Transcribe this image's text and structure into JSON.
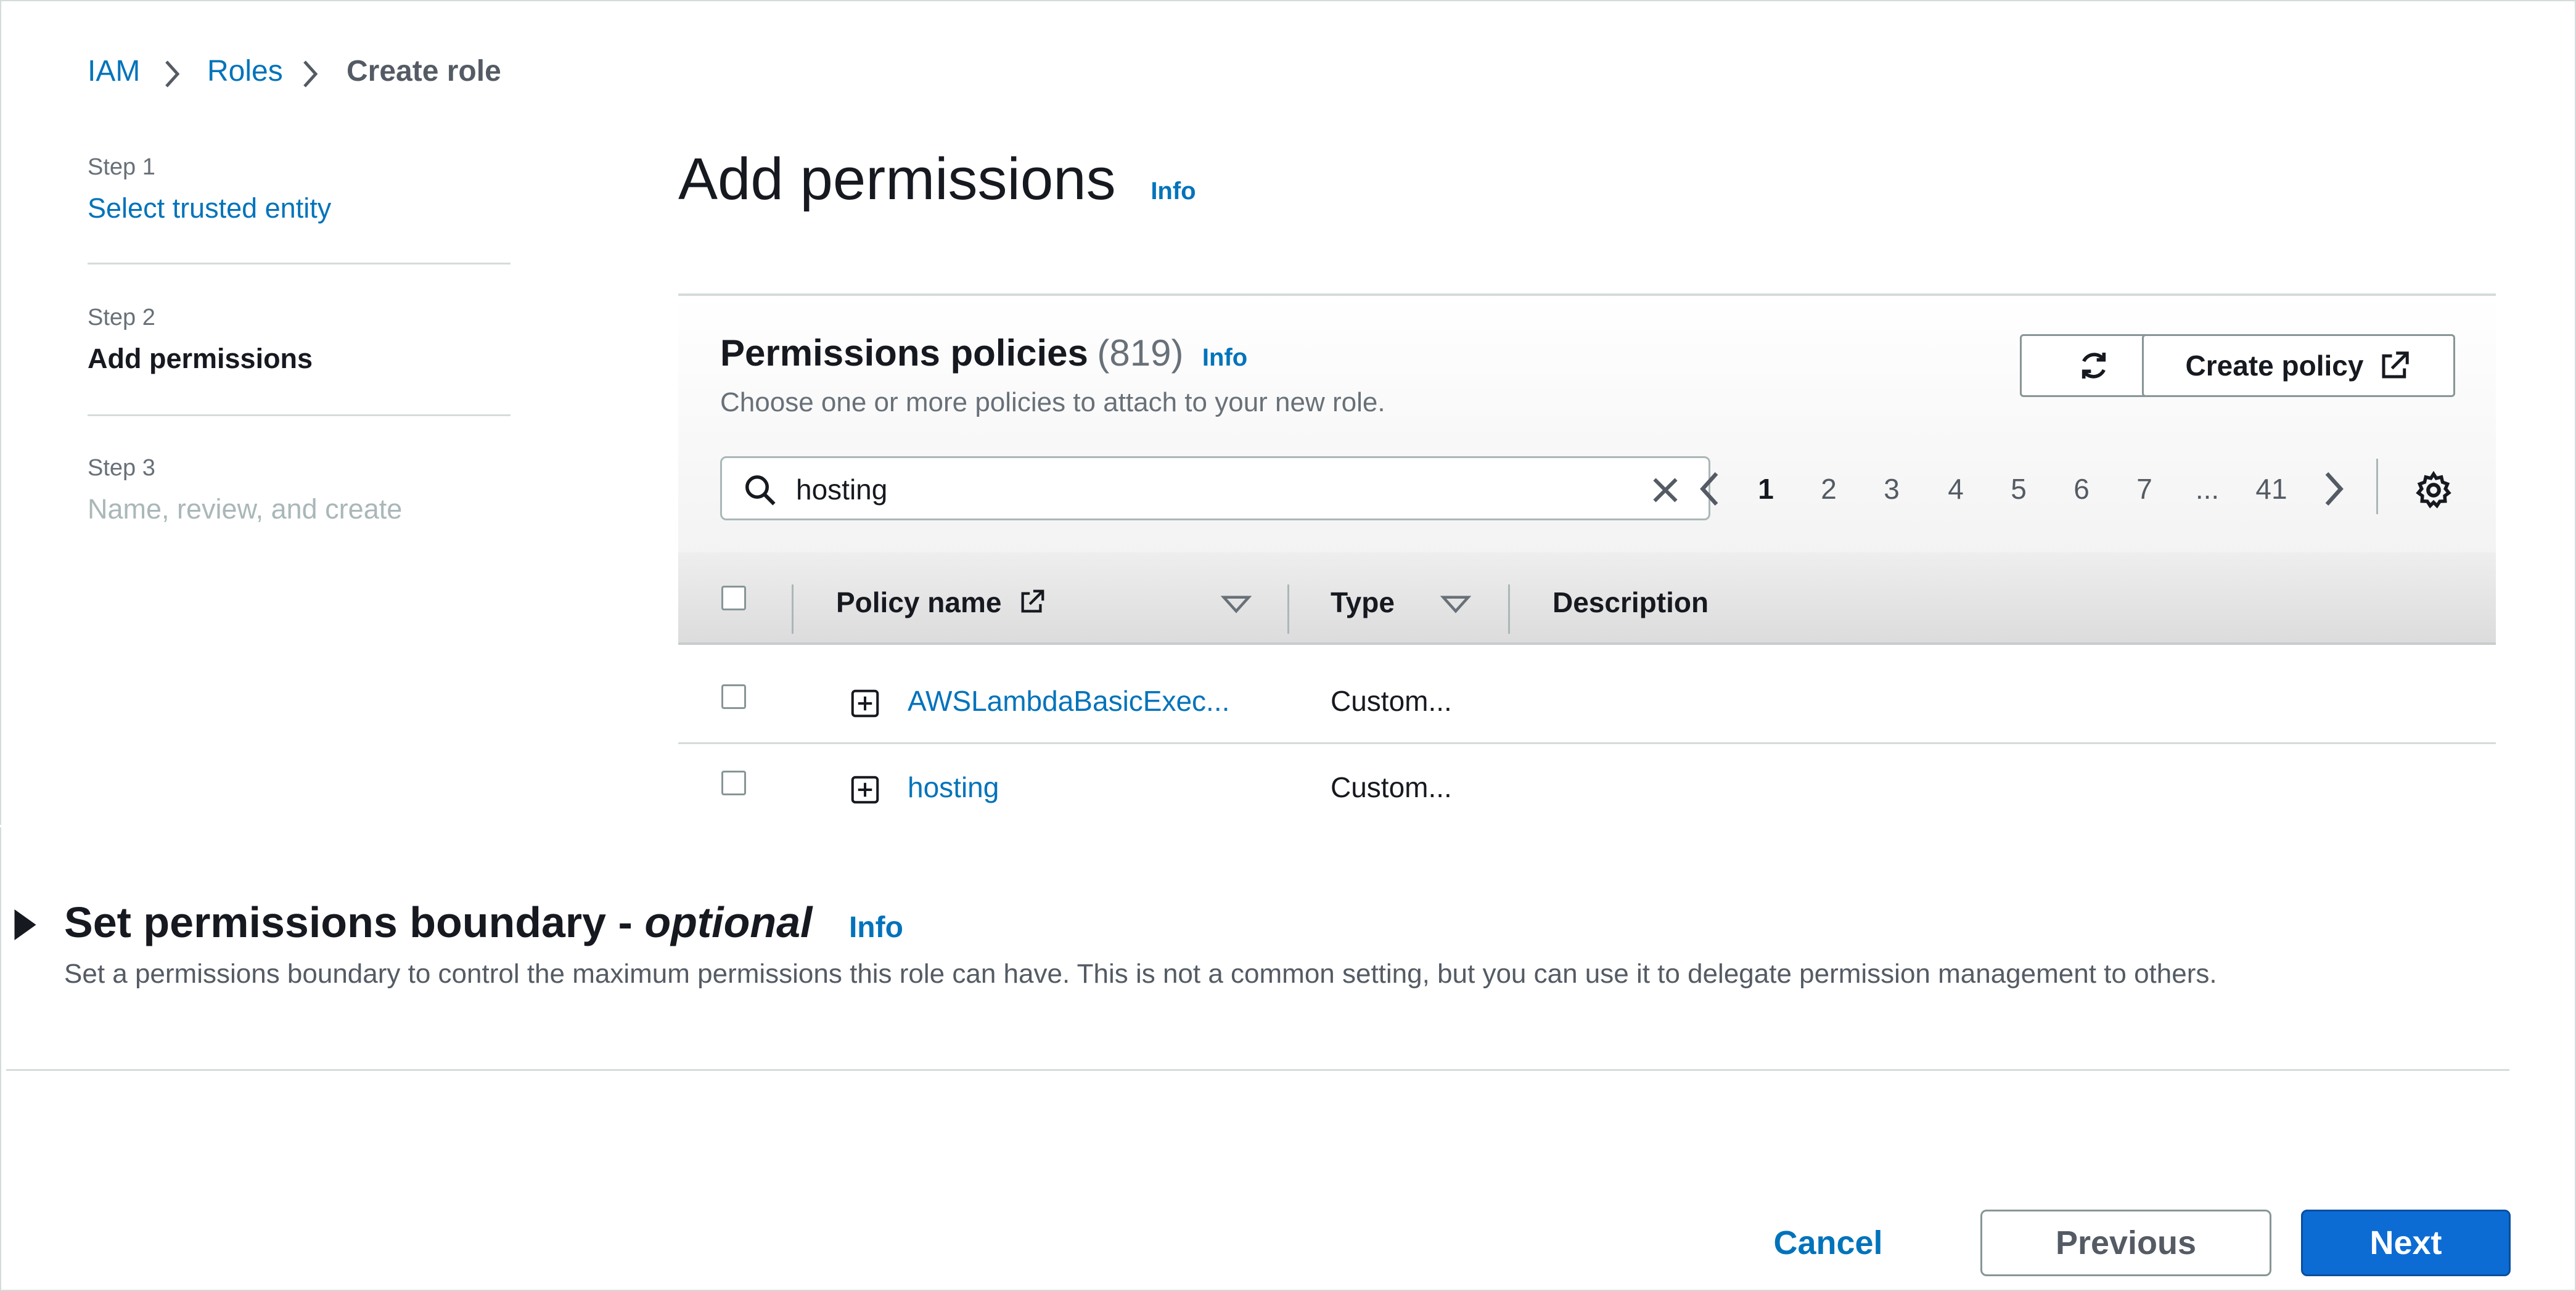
{
  "breadcrumb": {
    "items": [
      "IAM",
      "Roles",
      "Create role"
    ]
  },
  "steps": [
    {
      "step": "Step 1",
      "title": "Select trusted entity"
    },
    {
      "step": "Step 2",
      "title": "Add permissions"
    },
    {
      "step": "Step 3",
      "title": "Name, review, and create"
    }
  ],
  "page": {
    "title": "Add permissions",
    "info": "Info"
  },
  "permissions": {
    "title": "Permissions policies",
    "count": "(819)",
    "info": "Info",
    "subtitle": "Choose one or more policies to attach to your new role.",
    "create_policy_label": "Create policy",
    "search_value": "hosting",
    "pagination": {
      "pages": [
        "1",
        "2",
        "3",
        "4",
        "5",
        "6",
        "7",
        "...",
        "41"
      ],
      "current": "1"
    },
    "columns": {
      "policy_name": "Policy name",
      "type": "Type",
      "description": "Description"
    },
    "rows": [
      {
        "name": "AWSLambdaBasicExec...",
        "type": "Custom..."
      },
      {
        "name": "hosting",
        "type": "Custom..."
      }
    ]
  },
  "boundary": {
    "title": "Set permissions boundary - ",
    "title_optional": "optional",
    "info": "Info",
    "description": "Set a permissions boundary to control the maximum permissions this role can have. This is not a common setting, but you can use it to delegate permission management to others."
  },
  "footer": {
    "cancel": "Cancel",
    "previous": "Previous",
    "next": "Next"
  },
  "colors": {
    "link": "#0073bb",
    "primary": "#0c6cd4",
    "text": "#16191f",
    "muted": "#687078"
  }
}
